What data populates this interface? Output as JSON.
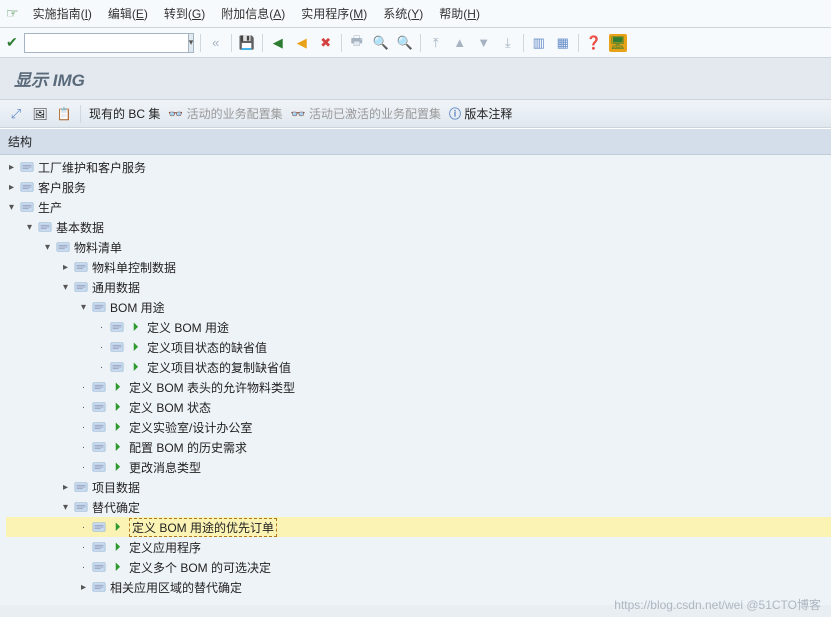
{
  "menu": {
    "items": [
      {
        "label": "实施指南",
        "key": "I"
      },
      {
        "label": "编辑",
        "key": "E"
      },
      {
        "label": "转到",
        "key": "G"
      },
      {
        "label": "附加信息",
        "key": "A"
      },
      {
        "label": "实用程序",
        "key": "M"
      },
      {
        "label": "系统",
        "key": "Y"
      },
      {
        "label": "帮助",
        "key": "H"
      }
    ]
  },
  "title": "显示 IMG",
  "appbar": {
    "bcset": "现有的 BC 集",
    "activeConfigSet": "活动的业务配置集",
    "activatedConfigSet": "活动已激活的业务配置集",
    "versionNotes": "版本注释"
  },
  "struct_header": "结构",
  "tree": [
    {
      "depth": 0,
      "toggle": "▸",
      "exec": false,
      "label": "工厂维护和客户服务"
    },
    {
      "depth": 0,
      "toggle": "▸",
      "exec": false,
      "label": "客户服务"
    },
    {
      "depth": 0,
      "toggle": "▾",
      "exec": false,
      "label": "生产"
    },
    {
      "depth": 1,
      "toggle": "▾",
      "exec": false,
      "label": "基本数据"
    },
    {
      "depth": 2,
      "toggle": "▾",
      "exec": false,
      "label": "物料清单"
    },
    {
      "depth": 3,
      "toggle": "▸",
      "exec": false,
      "label": "物料单控制数据"
    },
    {
      "depth": 3,
      "toggle": "▾",
      "exec": false,
      "label": "通用数据"
    },
    {
      "depth": 4,
      "toggle": "▾",
      "exec": false,
      "label": "BOM 用途"
    },
    {
      "depth": 5,
      "toggle": "·",
      "exec": true,
      "label": "定义 BOM 用途"
    },
    {
      "depth": 5,
      "toggle": "·",
      "exec": true,
      "label": "定义项目状态的缺省值"
    },
    {
      "depth": 5,
      "toggle": "·",
      "exec": true,
      "label": "定义项目状态的复制缺省值"
    },
    {
      "depth": 4,
      "toggle": "·",
      "exec": true,
      "label": "定义 BOM 表头的允许物料类型"
    },
    {
      "depth": 4,
      "toggle": "·",
      "exec": true,
      "label": "定义 BOM 状态"
    },
    {
      "depth": 4,
      "toggle": "·",
      "exec": true,
      "label": "定义实验室/设计办公室"
    },
    {
      "depth": 4,
      "toggle": "·",
      "exec": true,
      "label": "配置 BOM 的历史需求"
    },
    {
      "depth": 4,
      "toggle": "·",
      "exec": true,
      "label": "更改消息类型"
    },
    {
      "depth": 3,
      "toggle": "▸",
      "exec": false,
      "label": "项目数据"
    },
    {
      "depth": 3,
      "toggle": "▾",
      "exec": false,
      "label": "替代确定"
    },
    {
      "depth": 4,
      "toggle": "·",
      "exec": true,
      "label": "定义 BOM 用途的优先订单",
      "selected": true
    },
    {
      "depth": 4,
      "toggle": "·",
      "exec": true,
      "label": "定义应用程序"
    },
    {
      "depth": 4,
      "toggle": "·",
      "exec": true,
      "label": "定义多个 BOM 的可选决定"
    },
    {
      "depth": 4,
      "toggle": "▸",
      "exec": false,
      "label": "相关应用区域的替代确定"
    }
  ],
  "watermark": "https://blog.csdn.net/wei @51CTO博客"
}
